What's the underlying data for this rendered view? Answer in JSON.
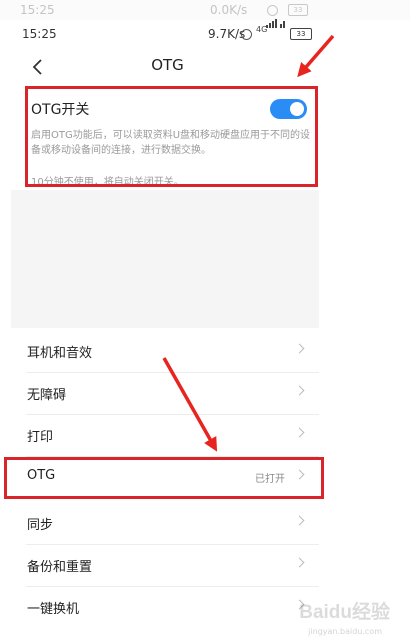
{
  "ghost_status": {
    "time": "15:25",
    "net": "0.0K/s"
  },
  "status_bar": {
    "time": "15:25",
    "net_speed": "9.7K/s",
    "signal": "4G",
    "battery": "33"
  },
  "header": {
    "title": "OTG"
  },
  "otg_switch": {
    "label": "OTG开关",
    "enabled": true,
    "description": "启用OTG功能后，可以读取资料U盘和移动硬盘应用于不同的设备或移动设备间的连接，进行数据交换。",
    "auto_off_note": "10分钟不使用，将自动关闭开关。"
  },
  "settings_list": [
    {
      "label": "耳机和音效",
      "value": ""
    },
    {
      "label": "无障碍",
      "value": ""
    },
    {
      "label": "打印",
      "value": ""
    },
    {
      "label": "OTG",
      "value": "已打开"
    },
    {
      "label": "同步",
      "value": ""
    },
    {
      "label": "备份和重置",
      "value": ""
    },
    {
      "label": "一键换机",
      "value": ""
    }
  ],
  "watermark": {
    "text": "Baidu经验",
    "url": "jingyan.baidu.com"
  },
  "colors": {
    "accent": "#2a8df5",
    "highlight": "#d9252a",
    "arrow": "#e8241f"
  }
}
